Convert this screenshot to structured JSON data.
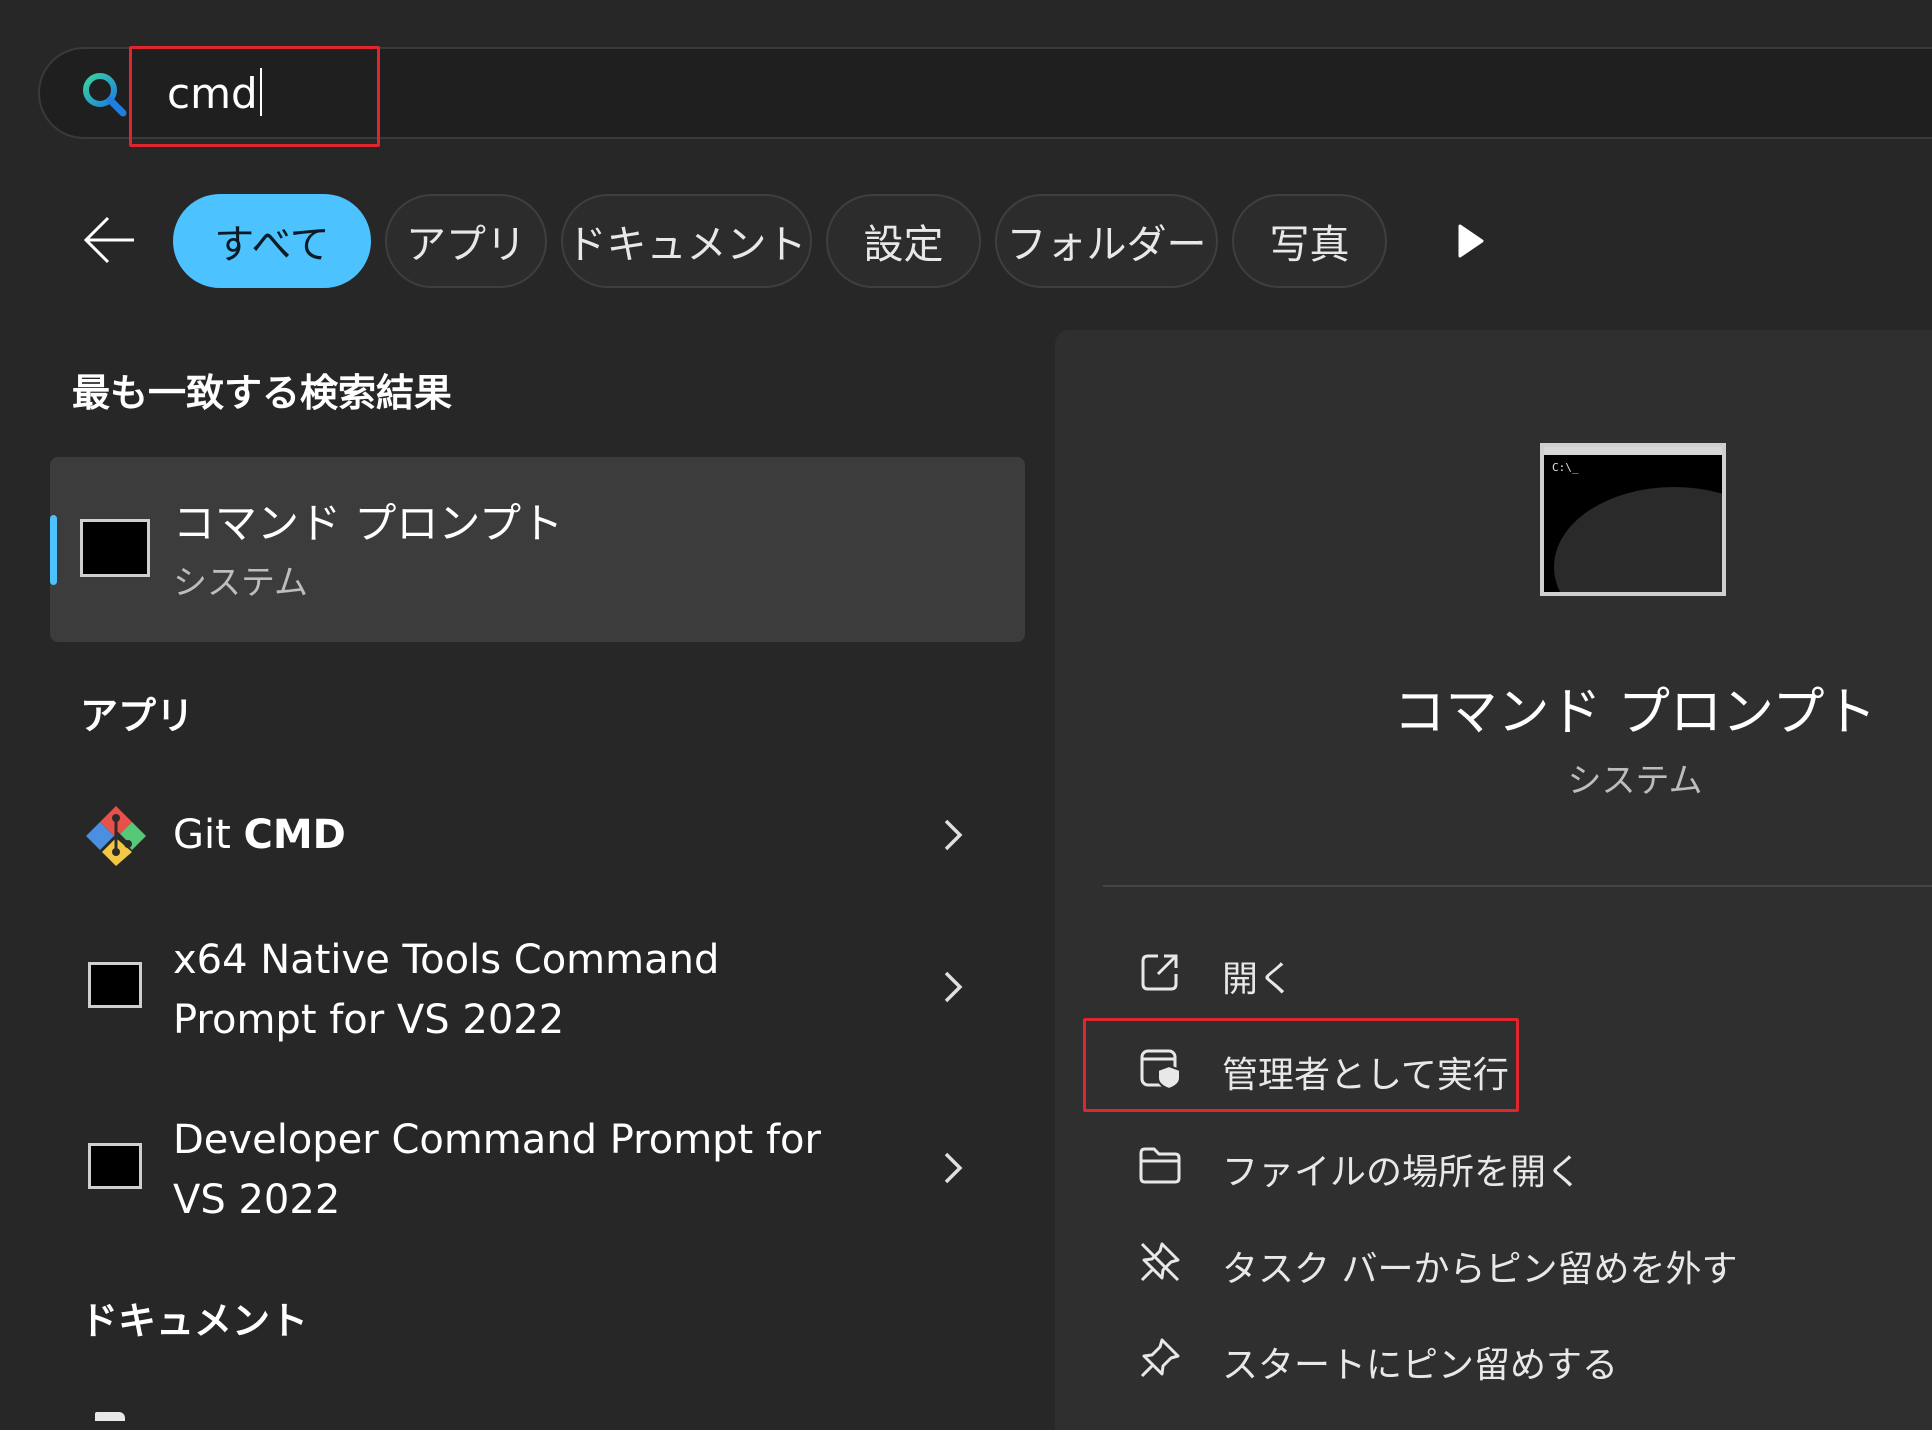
{
  "search": {
    "query": "cmd"
  },
  "filters": {
    "items": [
      "すべて",
      "アプリ",
      "ドキュメント",
      "設定",
      "フォルダー",
      "写真"
    ],
    "active_index": 0
  },
  "best_match": {
    "heading": "最も一致する検索結果",
    "name": "コマンド プロンプト",
    "type": "システム"
  },
  "apps": {
    "heading": "アプリ",
    "items": [
      {
        "name_plain": "Git ",
        "name_bold": "CMD",
        "icon": "git-icon"
      },
      {
        "line1": "x64 Native Tools Command",
        "line2": "Prompt for VS 2022",
        "icon": "cmd-icon"
      },
      {
        "line1": "Developer Command Prompt for",
        "line2": "VS 2022",
        "icon": "cmd-icon"
      }
    ]
  },
  "documents": {
    "heading": "ドキュメント"
  },
  "detail": {
    "name": "コマンド プロンプト",
    "type": "システム",
    "icon_prompt_text": "C:\\_",
    "actions": [
      {
        "label": "開く",
        "icon": "open-external-icon"
      },
      {
        "label": "管理者として実行",
        "icon": "shield-run-icon"
      },
      {
        "label": "ファイルの場所を開く",
        "icon": "folder-icon"
      },
      {
        "label": "タスク バーからピン留めを外す",
        "icon": "unpin-icon"
      },
      {
        "label": "スタートにピン留めする",
        "icon": "pin-icon"
      }
    ]
  },
  "colors": {
    "accent": "#4cc2ff",
    "highlight": "#e0262d",
    "background": "#272727",
    "panel": "#2f2f2f"
  }
}
